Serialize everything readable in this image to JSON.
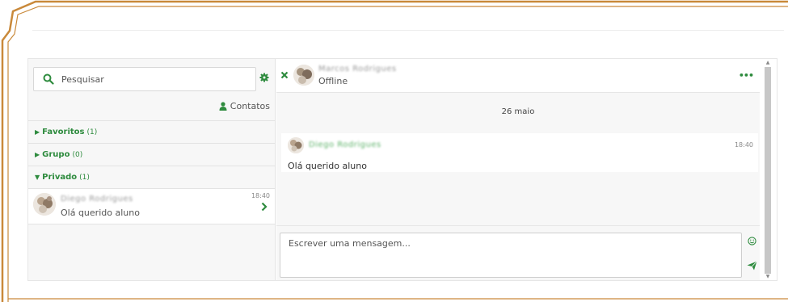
{
  "search": {
    "placeholder": "Pesquisar"
  },
  "contacts": {
    "label": "Contatos"
  },
  "sections": [
    {
      "label": "Favoritos",
      "count": "(1)",
      "expanded": false
    },
    {
      "label": "Grupo",
      "count": "(0)",
      "expanded": false
    },
    {
      "label": "Privado",
      "count": "(1)",
      "expanded": true
    }
  ],
  "conversation": {
    "name": "Diego Rodrigues",
    "last_message": "Olá querido aluno",
    "time": "18:40"
  },
  "chat": {
    "contact_name": "Marcos Rodrigues",
    "status": "Offline",
    "more_label": "•••",
    "date": "26 maio",
    "message": {
      "sender": "Diego Rodrigues",
      "time": "18:40",
      "text": "Olá querido aluno"
    }
  },
  "composer": {
    "placeholder": "Escrever uma mensagem..."
  },
  "icons": {
    "search": "search-icon",
    "settings": "gear-icon",
    "contacts": "user-icon",
    "open": "chevron-right-icon",
    "close": "close-icon",
    "emoji": "smiley-icon",
    "send": "send-icon"
  },
  "colors": {
    "accent": "#2e8b3e",
    "frame": "#c9893a"
  }
}
